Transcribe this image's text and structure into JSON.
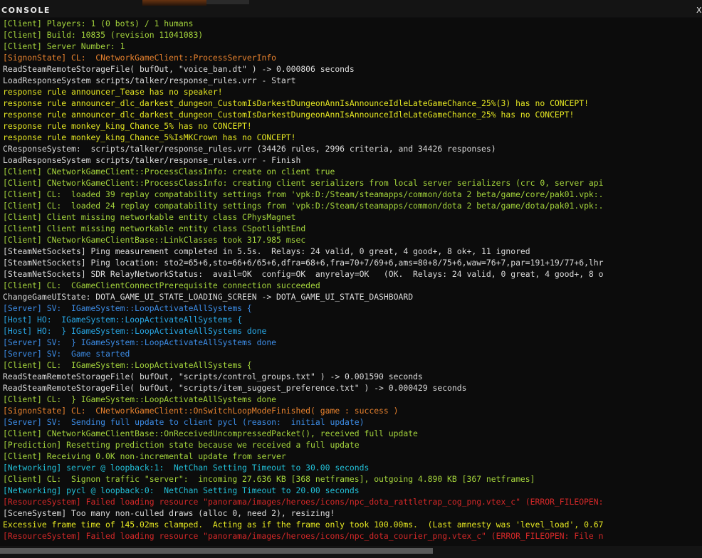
{
  "window": {
    "title": "CONSOLE",
    "close_label": "X"
  },
  "colors": {
    "client": "#a4d43c",
    "signon": "#e8822e",
    "default": "#dcdcdc",
    "warning": "#e4e622",
    "server": "#3c8ce6",
    "host": "#28a8e6",
    "networking": "#22c0d8",
    "error": "#d42828"
  },
  "lines": [
    {
      "text": "[Client] Players: 1 (0 bots) / 1 humans",
      "cat": "client"
    },
    {
      "text": "[Client] Build: 10835 (revision 11041083)",
      "cat": "client"
    },
    {
      "text": "[Client] Server Number: 1",
      "cat": "client"
    },
    {
      "text": "[SignonState] CL:  CNetworkGameClient::ProcessServerInfo",
      "cat": "signon"
    },
    {
      "text": "ReadSteamRemoteStorageFile( bufOut, \"voice_ban.dt\" ) -> 0.000806 seconds",
      "cat": "default"
    },
    {
      "text": "LoadResponseSystem scripts/talker/response_rules.vrr - Start",
      "cat": "default"
    },
    {
      "text": "response rule announcer_Tease has no speaker!",
      "cat": "warning"
    },
    {
      "text": "response rule announcer_dlc_darkest_dungeon_CustomIsDarkestDungeonAnnIsAnnounceIdleLateGameChance_25%(3) has no CONCEPT!",
      "cat": "warning"
    },
    {
      "text": "response rule announcer_dlc_darkest_dungeon_CustomIsDarkestDungeonAnnIsAnnounceIdleLateGameChance_25% has no CONCEPT!",
      "cat": "warning"
    },
    {
      "text": "response rule monkey_king_Chance_5% has no CONCEPT!",
      "cat": "warning"
    },
    {
      "text": "response rule monkey_king_Chance_5%IsMKCrown has no CONCEPT!",
      "cat": "warning"
    },
    {
      "text": "CResponseSystem:  scripts/talker/response_rules.vrr (34426 rules, 2996 criteria, and 34426 responses)",
      "cat": "default"
    },
    {
      "text": "LoadResponseSystem scripts/talker/response_rules.vrr - Finish",
      "cat": "default"
    },
    {
      "text": "[Client] CNetworkGameClient::ProcessClassInfo: create on client true",
      "cat": "client"
    },
    {
      "text": "[Client] CNetworkGameClient::ProcessClassInfo: creating client serializers from local server serializers (crc 0, server api",
      "cat": "client"
    },
    {
      "text": "[Client] CL:  loaded 39 replay compatability settings from 'vpk:D:/Steam/steamapps/common/dota 2 beta/game/core/pak01.vpk:.",
      "cat": "client"
    },
    {
      "text": "[Client] CL:  loaded 24 replay compatability settings from 'vpk:D:/Steam/steamapps/common/dota 2 beta/game/dota/pak01.vpk:.",
      "cat": "client"
    },
    {
      "text": "[Client] Client missing networkable entity class CPhysMagnet",
      "cat": "client"
    },
    {
      "text": "[Client] Client missing networkable entity class CSpotlightEnd",
      "cat": "client"
    },
    {
      "text": "[Client] CNetworkGameClientBase::LinkClasses took 317.985 msec",
      "cat": "client"
    },
    {
      "text": "[SteamNetSockets] Ping measurement completed in 5.5s.  Relays: 24 valid, 0 great, 4 good+, 8 ok+, 11 ignored",
      "cat": "default"
    },
    {
      "text": "[SteamNetSockets] Ping location: sto2=65+6,sto=66+6/65+6,dfra=68+6,fra=70+7/69+6,ams=80+8/75+6,waw=76+7,par=191+19/77+6,lhr",
      "cat": "default"
    },
    {
      "text": "[SteamNetSockets] SDR RelayNetworkStatus:  avail=OK  config=OK  anyrelay=OK   (OK.  Relays: 24 valid, 0 great, 4 good+, 8 o",
      "cat": "default"
    },
    {
      "text": "[Client] CL:  CGameClientConnectPrerequisite connection succeeded",
      "cat": "client"
    },
    {
      "text": "ChangeGameUIState: DOTA_GAME_UI_STATE_LOADING_SCREEN -> DOTA_GAME_UI_STATE_DASHBOARD",
      "cat": "default"
    },
    {
      "text": "[Server] SV:  IGameSystem::LoopActivateAllSystems {",
      "cat": "server"
    },
    {
      "text": "[Host] HO:  IGameSystem::LoopActivateAllSystems {",
      "cat": "host"
    },
    {
      "text": "[Host] HO:  } IGameSystem::LoopActivateAllSystems done",
      "cat": "host"
    },
    {
      "text": "[Server] SV:  } IGameSystem::LoopActivateAllSystems done",
      "cat": "server"
    },
    {
      "text": "[Server] SV:  Game started",
      "cat": "server"
    },
    {
      "text": "[Client] CL:  IGameSystem::LoopActivateAllSystems {",
      "cat": "client"
    },
    {
      "text": "ReadSteamRemoteStorageFile( bufOut, \"scripts/control_groups.txt\" ) -> 0.001590 seconds",
      "cat": "default"
    },
    {
      "text": "ReadSteamRemoteStorageFile( bufOut, \"scripts/item_suggest_preference.txt\" ) -> 0.000429 seconds",
      "cat": "default"
    },
    {
      "text": "[Client] CL:  } IGameSystem::LoopActivateAllSystems done",
      "cat": "client"
    },
    {
      "text": "[SignonState] CL:  CNetworkGameClient::OnSwitchLoopModeFinished( game : success )",
      "cat": "signon"
    },
    {
      "text": "[Server] SV:  Sending full update to client pycl (reason:  initial update)",
      "cat": "server"
    },
    {
      "text": "[Client] CNetworkGameClientBase::OnReceivedUncompressedPacket(), received full update",
      "cat": "client"
    },
    {
      "text": "[Prediction] Resetting prediction state because we received a full update",
      "cat": "client"
    },
    {
      "text": "[Client] Receiving 0.0K non-incremental update from server",
      "cat": "client"
    },
    {
      "text": "[Networking] server @ loopback:1:  NetChan Setting Timeout to 30.00 seconds",
      "cat": "networking"
    },
    {
      "text": "[Client] CL:  Signon traffic \"server\":  incoming 27.636 KB [368 netframes], outgoing 4.890 KB [367 netframes]",
      "cat": "client"
    },
    {
      "text": "[Networking] pycl @ loopback:0:  NetChan Setting Timeout to 20.00 seconds",
      "cat": "networking"
    },
    {
      "text": "[ResourceSystem] Failed loading resource \"panorama/images/heroes/icons/npc_dota_rattletrap_cog_png.vtex_c\" (ERROR_FILEOPEN:",
      "cat": "error"
    },
    {
      "text": "[SceneSystem] Too many non-culled draws (alloc 0, need 2), resizing!",
      "cat": "default"
    },
    {
      "text": "Excessive frame time of 145.02ms clamped.  Acting as if the frame only took 100.00ms.  (Last amnesty was 'level_load', 0.67",
      "cat": "warning"
    },
    {
      "text": "[ResourceSystem] Failed loading resource \"panorama/images/heroes/icons/npc_dota_courier_png.vtex_c\" (ERROR_FILEOPEN: File n",
      "cat": "error"
    }
  ]
}
